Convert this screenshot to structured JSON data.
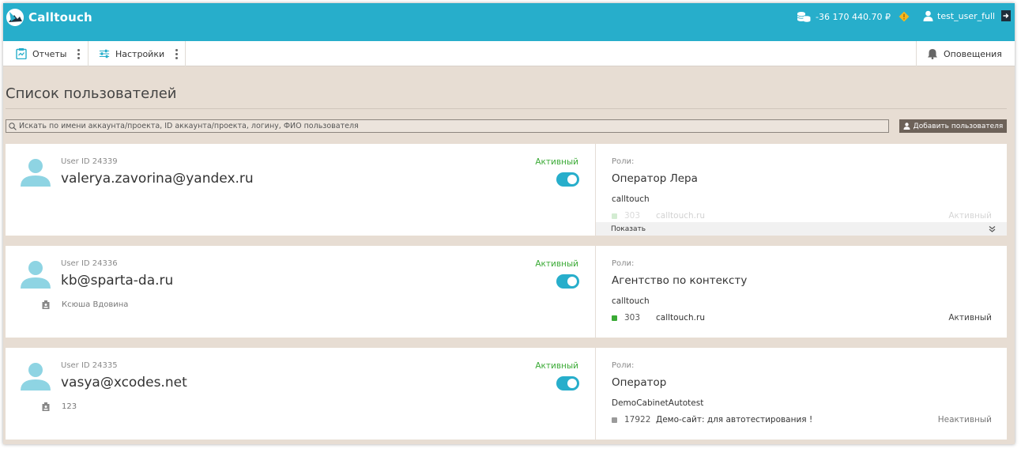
{
  "header": {
    "logo_text": "Calltouch",
    "balance": "-36 170 440.70 ₽",
    "username": "test_user_full",
    "colors": {
      "bar": "#27aecb",
      "warn": "#f4b81f"
    }
  },
  "toolbar": {
    "reports_label": "Отчеты",
    "settings_label": "Настройки",
    "notifications_label": "Оповещения"
  },
  "page": {
    "title": "Список пользователей",
    "search_placeholder": "Искать по имени аккаунта/проекта, ID аккаунта/проекта, логину, ФИО пользователя",
    "add_user_label": "Добавить пользователя"
  },
  "users": [
    {
      "uid": "User ID 24339",
      "email": "valerya.zavorina@yandex.ru",
      "fio": "",
      "status": "Активный",
      "enabled": true,
      "roles_label": "Роли:",
      "role": "Оператор Лера",
      "company": "calltouch",
      "project_id": "303",
      "project_name": "calltouch.ru",
      "project_status": "Активный",
      "project_active": true,
      "show_label": "Показать"
    },
    {
      "uid": "User ID 24336",
      "email": "kb@sparta-da.ru",
      "fio": "Ксюша Вдовина",
      "status": "Активный",
      "enabled": true,
      "roles_label": "Роли:",
      "role": "Агентство по контексту",
      "company": "calltouch",
      "project_id": "303",
      "project_name": "calltouch.ru",
      "project_status": "Активный",
      "project_active": true
    },
    {
      "uid": "User ID 24335",
      "email": "vasya@xcodes.net",
      "fio": "123",
      "status": "Активный",
      "enabled": true,
      "roles_label": "Роли:",
      "role": "Оператор",
      "company": "DemoCabinetAutotest",
      "project_id": "17922",
      "project_name": "Демо-сайт: для автотестирования !",
      "project_status": "Неактивный",
      "project_active": false
    }
  ]
}
